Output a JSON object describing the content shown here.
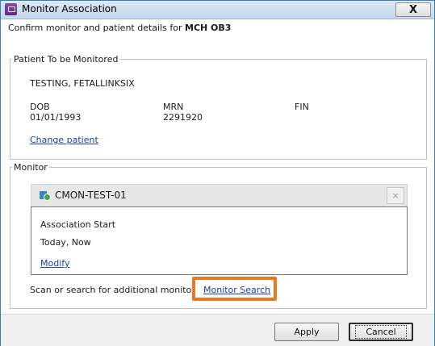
{
  "window": {
    "title": "Monitor Association",
    "close_label": "X",
    "subtitle_prefix": "Confirm monitor and patient details for ",
    "subtitle_bold": "MCH OB3"
  },
  "patient": {
    "legend": "Patient To be Monitored",
    "name": "TESTING, FETALLINKSIX",
    "dob_label": "DOB",
    "dob_value": "01/01/1993",
    "mrn_label": "MRN",
    "mrn_value": "2291920",
    "fin_label": "FIN",
    "change_link": "Change patient"
  },
  "monitor": {
    "legend": "Monitor",
    "device_name": "CMON-TEST-01",
    "remove_label": "×",
    "association_label": "Association Start",
    "association_value": "Today, Now",
    "modify_link": "Modify",
    "scan_text": "Scan or search for additional monitor",
    "search_link": "Monitor Search"
  },
  "footer": {
    "apply_label": "Apply",
    "cancel_label": "Cancel"
  },
  "colors": {
    "highlight": "#e87b22",
    "link": "#1f3ca8",
    "titlebar": "#c4d7ec"
  },
  "icons": {
    "app": "monitor-association-app-icon",
    "device": "monitor-device-icon"
  }
}
